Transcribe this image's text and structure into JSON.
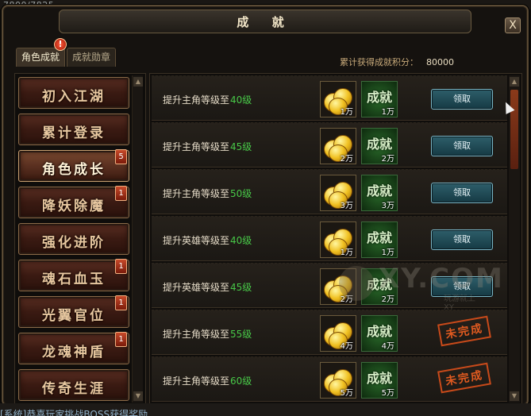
{
  "hud": {
    "hp": "7800/7825"
  },
  "window": {
    "title": "成 就",
    "close": "X"
  },
  "tabs": [
    {
      "label": "角色成就",
      "active": true
    },
    {
      "label": "成就勋章",
      "active": false
    }
  ],
  "alert_badge": "!",
  "score": {
    "label": "累计获得成就积分：",
    "value": "80000"
  },
  "categories": [
    {
      "label": "初入江湖",
      "badge": ""
    },
    {
      "label": "累计登录",
      "badge": ""
    },
    {
      "label": "角色成长",
      "badge": "5",
      "active": true
    },
    {
      "label": "降妖除魔",
      "badge": "1"
    },
    {
      "label": "强化进阶",
      "badge": ""
    },
    {
      "label": "魂石血玉",
      "badge": "1"
    },
    {
      "label": "光翼官位",
      "badge": "1"
    },
    {
      "label": "龙魂神盾",
      "badge": "1"
    },
    {
      "label": "传奇生涯",
      "badge": ""
    }
  ],
  "achievements": [
    {
      "text": "提升主角等级至",
      "level": "40级",
      "gold": "1万",
      "points": "1万",
      "points_label": "成就",
      "status": "claim",
      "button": "领取"
    },
    {
      "text": "提升主角等级至",
      "level": "45级",
      "gold": "2万",
      "points": "2万",
      "points_label": "成就",
      "status": "claim",
      "button": "领取"
    },
    {
      "text": "提升主角等级至",
      "level": "50级",
      "gold": "3万",
      "points": "3万",
      "points_label": "成就",
      "status": "claim",
      "button": "领取"
    },
    {
      "text": "提升英雄等级至",
      "level": "40级",
      "gold": "1万",
      "points": "1万",
      "points_label": "成就",
      "status": "claim",
      "button": "领取"
    },
    {
      "text": "提升英雄等级至",
      "level": "45级",
      "gold": "2万",
      "points": "2万",
      "points_label": "成就",
      "status": "claim",
      "button": "领取"
    },
    {
      "text": "提升主角等级至",
      "level": "55级",
      "gold": "4万",
      "points": "4万",
      "points_label": "成就",
      "status": "incomplete",
      "stamp": "未完成"
    },
    {
      "text": "提升主角等级至",
      "level": "60级",
      "gold": "5万",
      "points": "5万",
      "points_label": "成就",
      "status": "incomplete",
      "stamp": "未完成"
    }
  ],
  "watermark": {
    "text": "XY.COM",
    "sub": "玩游就上XY"
  },
  "bottom_chat": "[系统]恭喜玩家挑战BOSS获得奖励",
  "colors": {
    "level_green": "#48c848",
    "claim_button": "#2e5e6a",
    "stamp_orange": "#c84a1a"
  }
}
